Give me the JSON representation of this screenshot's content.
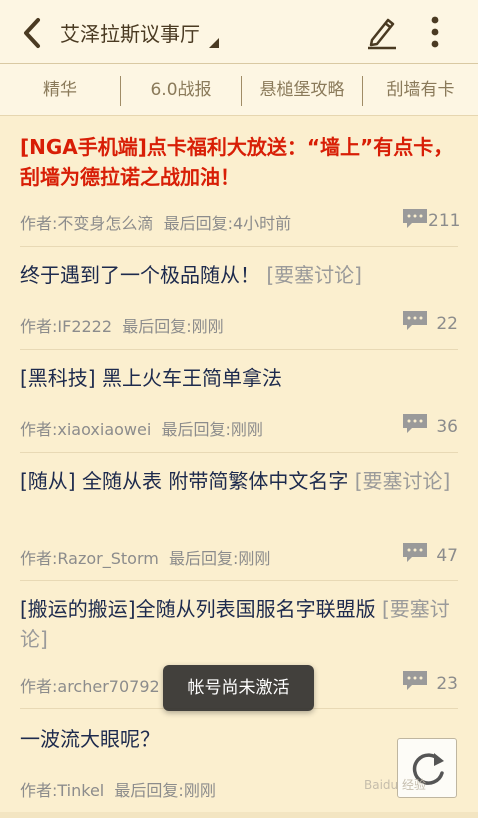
{
  "header": {
    "title": "艾泽拉斯议事厅",
    "back_icon": "chevron-left-icon",
    "edit_icon": "pencil-icon",
    "more_icon": "more-vertical-icon"
  },
  "tabs": [
    {
      "label": "精华"
    },
    {
      "label": "6.0战报"
    },
    {
      "label": "悬槌堡攻略"
    },
    {
      "label": "刮墙有卡"
    }
  ],
  "posts": [
    {
      "title": "[NGA手机端]点卡福利大放送：“墙上”有点卡，刮墙为德拉诺之战加油！",
      "tag": "",
      "author": "作者:不变身怎么滴",
      "last_reply": "最后回复:4小时前",
      "replies": "211"
    },
    {
      "title": "终于遇到了一个极品随从！",
      "tag": "[要塞讨论]",
      "author": "作者:IF2222",
      "last_reply": "最后回复:刚刚",
      "replies": "22"
    },
    {
      "title": "[黑科技] 黑上火车王简单拿法",
      "tag": "",
      "author": "作者:xiaoxiaowei",
      "last_reply": "最后回复:刚刚",
      "replies": "36"
    },
    {
      "title": "[随从] 全随从表 附带简繁体中文名字",
      "tag": "[要塞讨论]",
      "author": "作者:Razor_Storm",
      "last_reply": "最后回复:刚刚",
      "replies": "47"
    },
    {
      "title": "[搬运的搬运]全随从列表国服名字联盟版",
      "tag": "[要塞讨论]",
      "author": "作者:archer70792",
      "last_reply": "",
      "replies": "23"
    },
    {
      "title": "一波流大眼呢？",
      "tag": "",
      "author": "作者:Tinkel",
      "last_reply": "最后回复:刚刚",
      "replies": ""
    }
  ],
  "toast": {
    "message": "帐号尚未激活"
  },
  "refresh": {
    "icon": "refresh-icon"
  },
  "watermark": {
    "text": "Baidu 经验"
  },
  "colors": {
    "background": "#fbefcf",
    "header": "#fdf6e3",
    "hot_title": "#d81e06",
    "title": "#1d2a4d",
    "tag": "#9a9a9a",
    "meta": "#8c8c8c"
  }
}
